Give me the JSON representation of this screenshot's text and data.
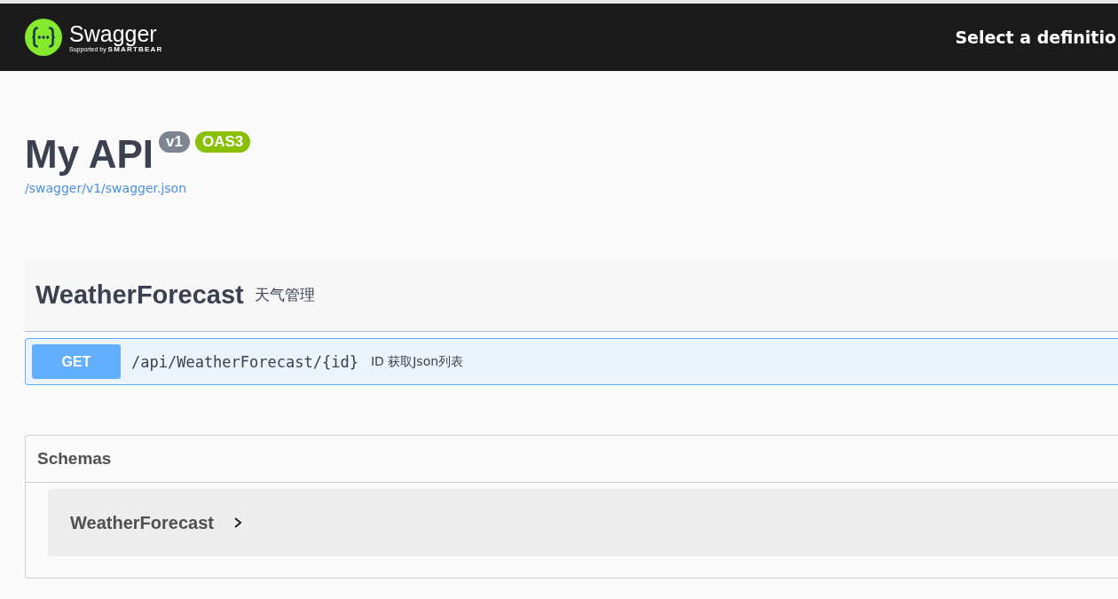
{
  "topbar": {
    "logo_name": "Swagger",
    "logo_tagline_prefix": "Supported by",
    "logo_tagline_brand": "SMARTBEAR",
    "definition_label": "Select a definitio"
  },
  "info": {
    "title": "My API",
    "version": "v1",
    "spec_badge": "OAS3",
    "spec_link": "/swagger/v1/swagger.json"
  },
  "tags": [
    {
      "name": "WeatherForecast",
      "description": "天气管理",
      "operations": [
        {
          "method": "GET",
          "path": "/api/WeatherForecast/{id}",
          "summary": "ID 获取Json列表"
        }
      ]
    }
  ],
  "schemas": {
    "title": "Schemas",
    "models": [
      {
        "name": "WeatherForecast",
        "expanded": false
      }
    ]
  }
}
